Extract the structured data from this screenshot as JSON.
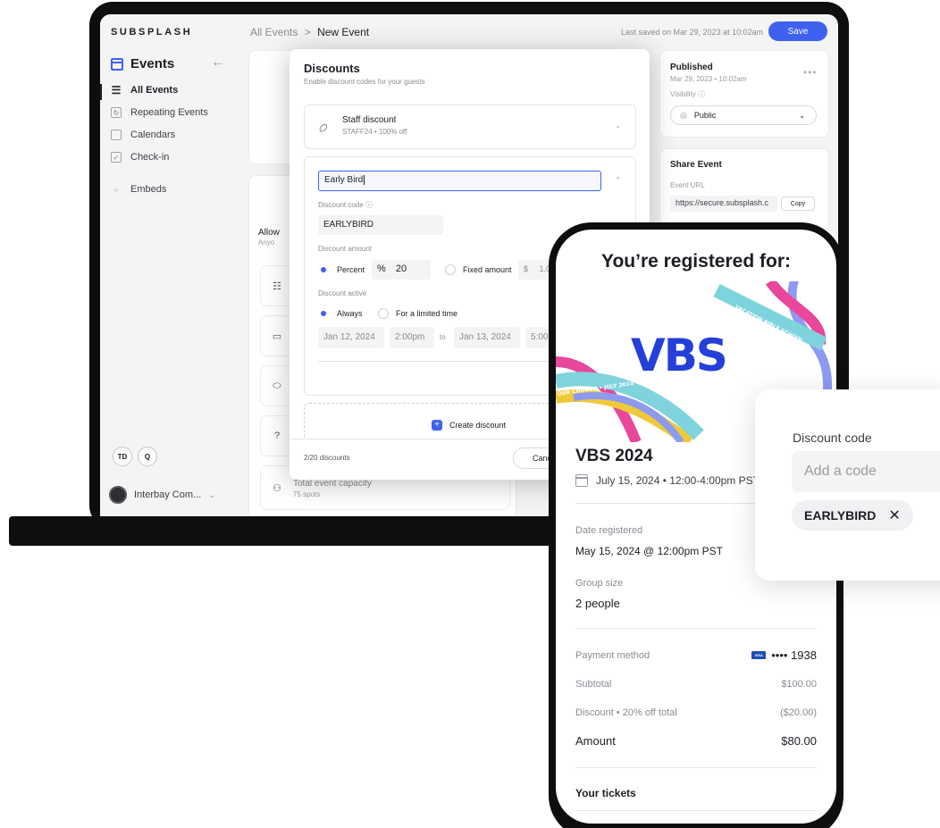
{
  "sidebar": {
    "logo": "SUBSPLASH",
    "section_title": "Events",
    "items": [
      {
        "label": "All Events",
        "icon": "list-icon"
      },
      {
        "label": "Repeating Events",
        "icon": "repeat-icon"
      },
      {
        "label": "Calendars",
        "icon": "calendar-icon"
      },
      {
        "label": "Check-in",
        "icon": "checkbox-icon"
      },
      {
        "label": "Embeds",
        "icon": "code-icon"
      }
    ],
    "bottom_chip_1": "TD",
    "bottom_chip_2": "Q",
    "org_name": "Interbay Com..."
  },
  "topbar": {
    "crumb_root": "All Events",
    "crumb_sep": ">",
    "crumb_current": "New Event",
    "last_saved": "Last saved on Mar 29, 2023 at 10:02am",
    "save_label": "Save"
  },
  "background_form": {
    "allow_label": "Allow",
    "anyone_label": "Anyo",
    "capacity_label": "Total event capacity",
    "capacity_value": "75 spots"
  },
  "right_panel": {
    "published_title": "Published",
    "published_date": "Mar 29, 2023 • 10:02am",
    "visibility_label": "Visibility",
    "visibility_value": "Public",
    "share_title": "Share Event",
    "url_label": "Event URL",
    "url_value": "https://secure.subsplash.c",
    "copy_label": "Copy"
  },
  "modal": {
    "title": "Discounts",
    "subtitle": "Enable discount codes for your guests",
    "existing_discount": {
      "name": "Staff discount",
      "meta": "STAFF24 • 100% off"
    },
    "editing": {
      "name_value": "Early Bird",
      "code_label": "Discount code",
      "code_value": "EARLYBIRD",
      "amount_label": "Discount amount",
      "percent_label": "Percent",
      "percent_symbol": "%",
      "percent_value": "20",
      "fixed_label": "Fixed amount",
      "fixed_symbol": "$",
      "fixed_value": "1.00",
      "active_label": "Discount active",
      "always_label": "Always",
      "limited_label": "For a limited time",
      "start_date": "Jan 12, 2024",
      "start_time": "2:00pm",
      "to_label": "to",
      "end_date": "Jan 13, 2024",
      "end_time": "5:00pm"
    },
    "create_label": "Create discount",
    "count_label": "2/20 discounts",
    "cancel_label": "Cancel"
  },
  "phone": {
    "heading": "You’re registered for:",
    "art_main_text": "VBS",
    "art_ribbon_1": "VACATION BIBLE SCHOOL",
    "art_ribbon_2": "OUR CHURCH • JULY 2024",
    "event_title": "VBS 2024",
    "event_date": "July 15, 2024 • 12:00-4:00pm PST",
    "date_registered_label": "Date registered",
    "date_registered_value": "May 15, 2024 @ 12:00pm PST",
    "group_size_label": "Group size",
    "group_size_value": "2 people",
    "payment_label": "Payment method",
    "card_brand": "VISA",
    "card_last4": "•••• 1938",
    "subtotal_label": "Subtotal",
    "subtotal_value": "$100.00",
    "discount_label": "Discount • 20% off total",
    "discount_value": "($20.00)",
    "amount_label": "Amount",
    "amount_value": "$80.00",
    "tickets_label": "Your tickets"
  },
  "popover": {
    "label": "Discount code",
    "placeholder": "Add a code",
    "applied_code": "EARLYBIRD"
  },
  "colors": {
    "accent": "#3f61f0",
    "frame": "#0e0e10",
    "vbs_blue": "#2440d8",
    "ribbon_teal": "#7fd3dc",
    "ribbon_pink": "#e8479a",
    "ribbon_yellow": "#f0c93a",
    "ribbon_periwinkle": "#8c9af0"
  }
}
